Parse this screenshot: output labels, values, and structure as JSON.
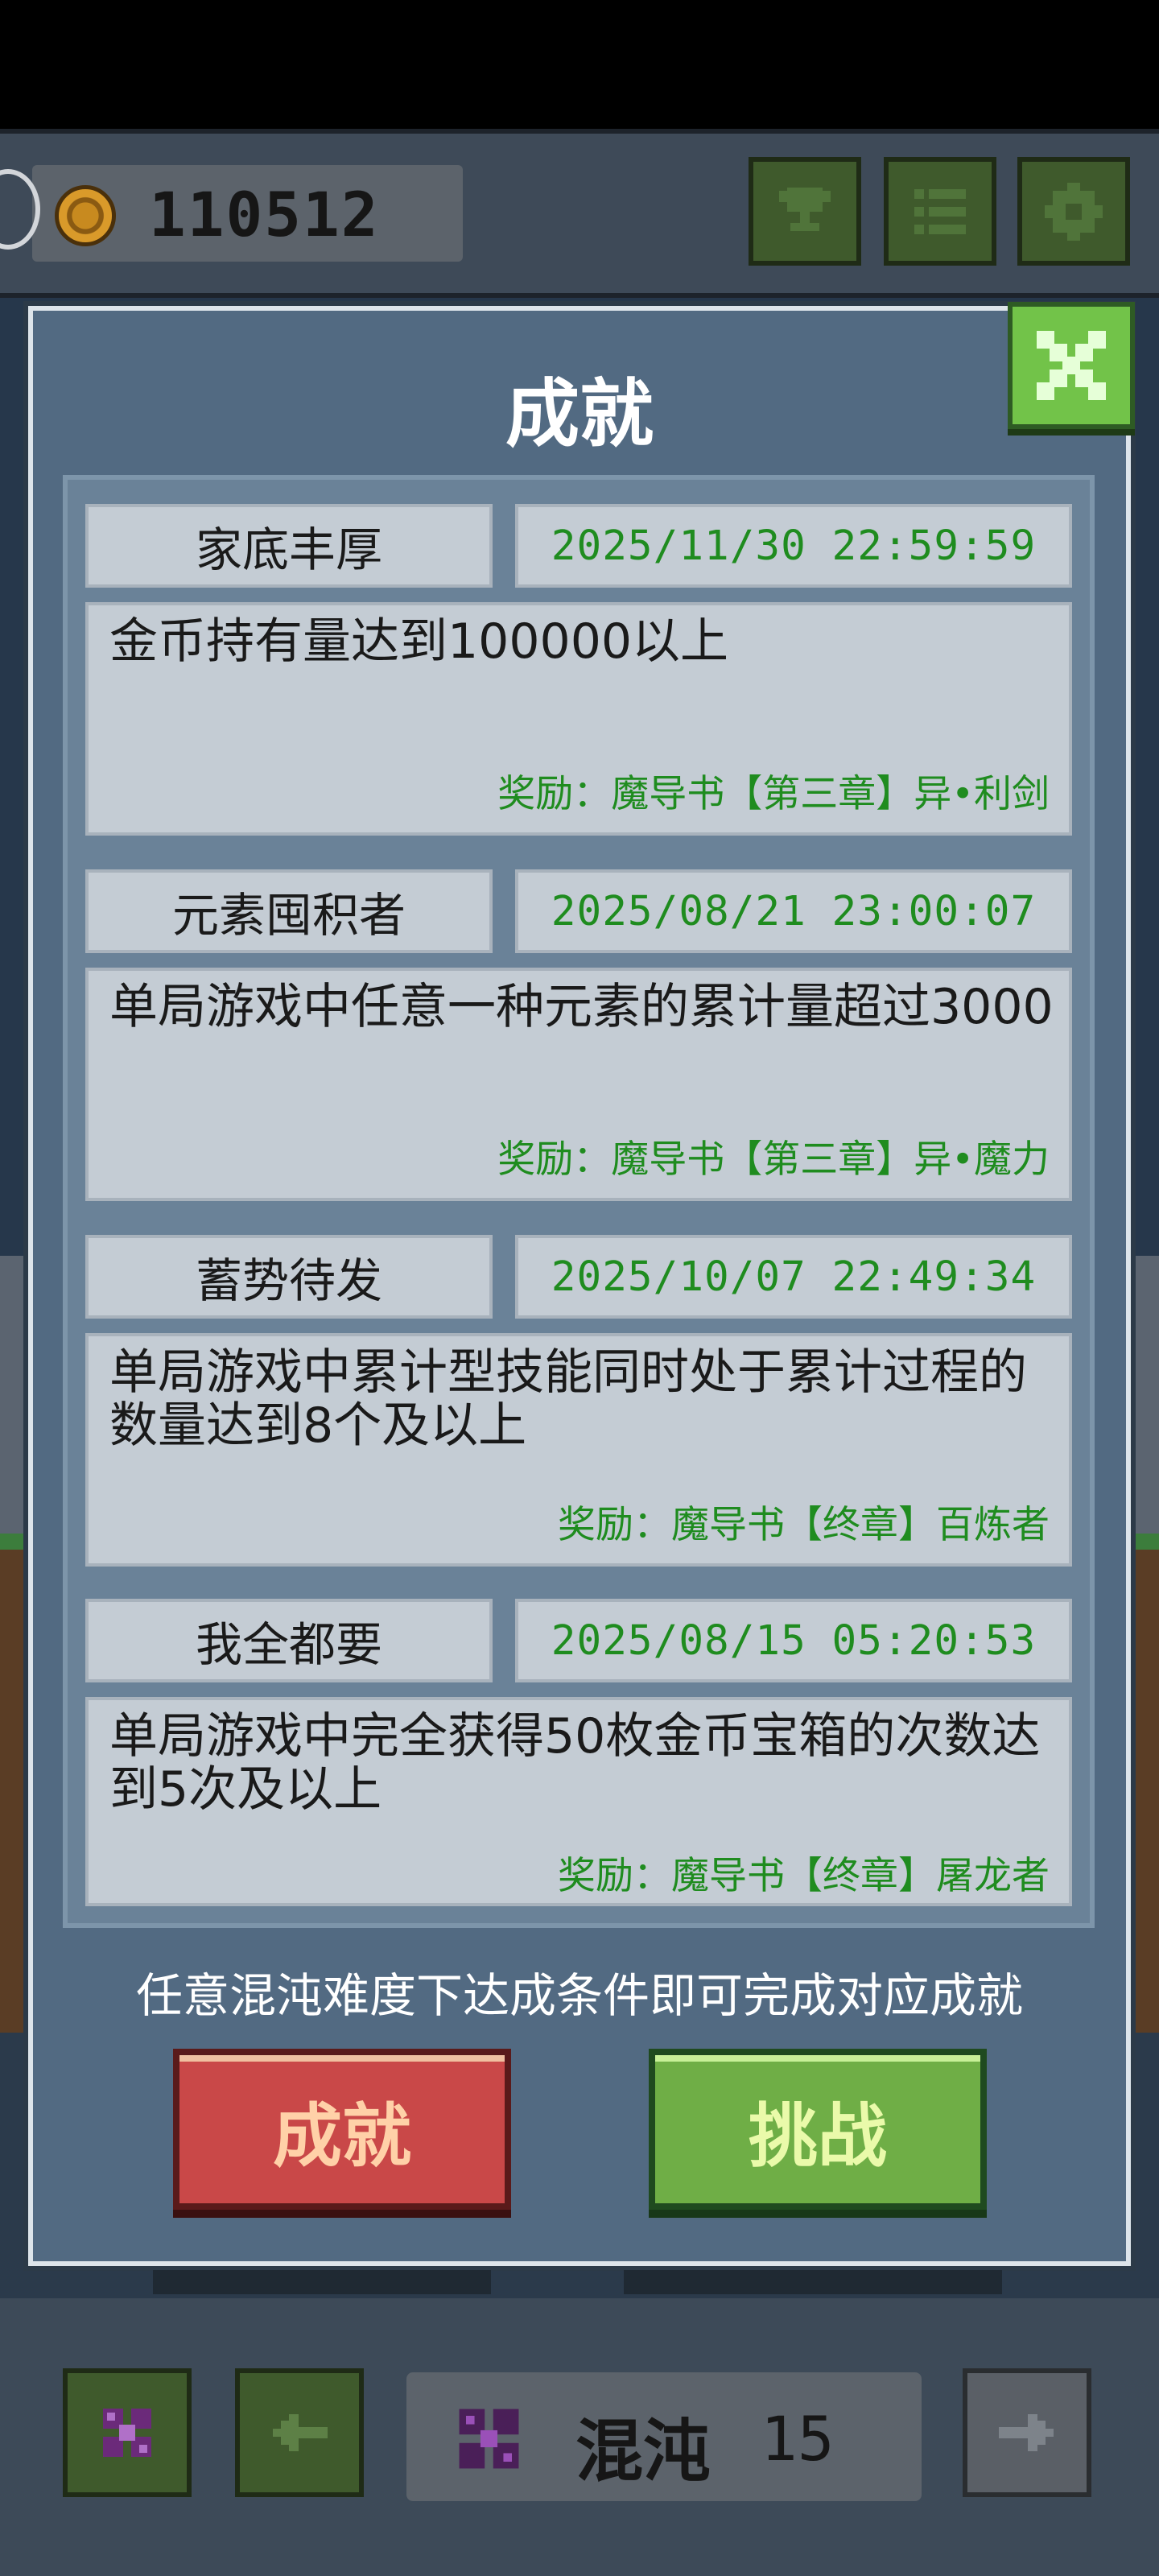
{
  "top_bar": {
    "coins": "110512",
    "icons": {
      "coin": "coin-icon",
      "trophy": "trophy-icon",
      "list": "list-icon",
      "settings": "gear-icon"
    }
  },
  "modal": {
    "title": "成就",
    "close_icon": "close-icon",
    "achievements": [
      {
        "name": "家底丰厚",
        "date": "2025/11/30 22:59:59",
        "description": "金币持有量达到100000以上",
        "reward": "奖励：魔导书【第三章】异•利剑"
      },
      {
        "name": "元素囤积者",
        "date": "2025/08/21 23:00:07",
        "description": "单局游戏中任意一种元素的累计量超过3000",
        "reward": "奖励：魔导书【第三章】异•魔力"
      },
      {
        "name": "蓄势待发",
        "date": "2025/10/07 22:49:34",
        "description": "单局游戏中累计型技能同时处于累计过程的数量达到8个及以上",
        "reward": "奖励：魔导书【终章】百炼者"
      },
      {
        "name": "我全都要",
        "date": "2025/08/15 05:20:53",
        "description": "单局游戏中完全获得50枚金币宝箱的次数达到5次及以上",
        "reward": "奖励：魔导书【终章】屠龙者"
      }
    ],
    "hint": "任意混沌难度下达成条件即可完成对应成就",
    "achievements_button": "成就",
    "challenge_button": "挑战"
  },
  "bottom_bar": {
    "difficulty_name": "混沌",
    "difficulty_level": "15",
    "icons": {
      "gem": "chaos-gem-icon",
      "prev": "arrow-left-icon",
      "next": "arrow-right-icon"
    }
  },
  "colors": {
    "modal_bg": "#526a82",
    "date_green": "#1f8c1f",
    "close_green": "#72c349",
    "achievements_red": "#c94848",
    "challenge_green": "#6fae46"
  }
}
